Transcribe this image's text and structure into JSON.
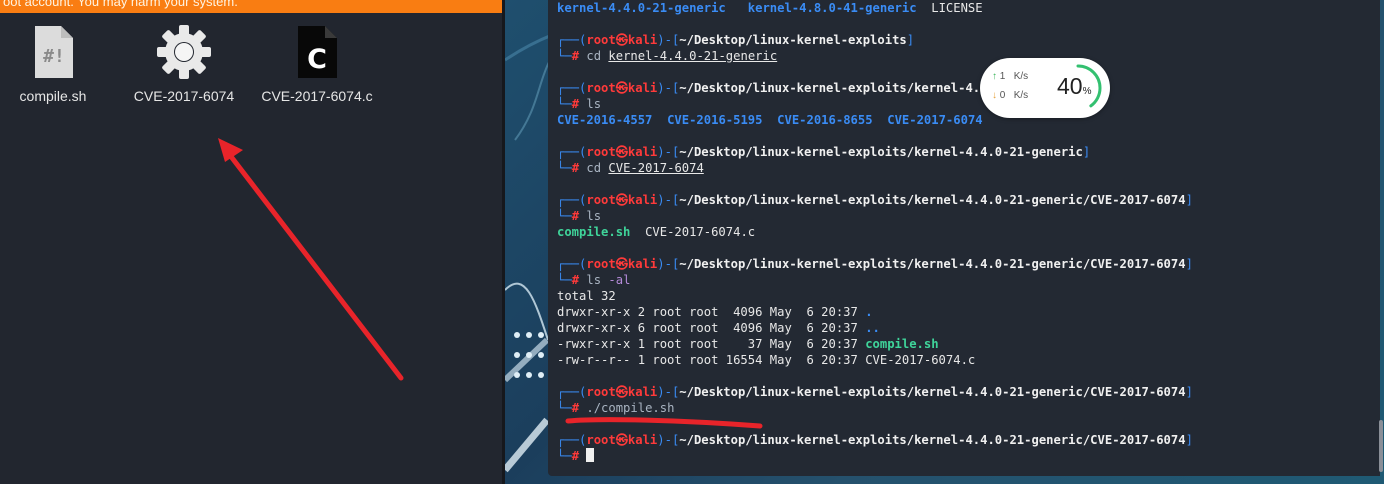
{
  "warning_banner": "oot account. You may harm your system.",
  "files": [
    {
      "name": "compile.sh",
      "icon": "shell-script-icon"
    },
    {
      "name": "CVE-2017-6074",
      "icon": "gear-executable-icon"
    },
    {
      "name": "CVE-2017-6074.c",
      "icon": "c-source-file-icon"
    }
  ],
  "icons": {
    "shell_glyph": "#!",
    "c_glyph": "C"
  },
  "network": {
    "up_value": "1",
    "up_unit": "K/s",
    "down_value": "0",
    "down_unit": "K/s",
    "percent": "40",
    "percent_sign": "%",
    "percent_fraction": 0.4
  },
  "terminal": {
    "line0": {
      "a": "kernel-4.4.0-21-generic",
      "b": "kernel-4.8.0-41-generic",
      "c": "LICENSE"
    },
    "prompt_user": "root",
    "prompt_at": "㉿",
    "prompt_host": "kali",
    "hash": "#",
    "blocks": [
      {
        "path": "~/Desktop/linux-kernel-exploits",
        "cmd": "cd",
        "arg": "kernel-4.4.0-21-generic"
      },
      {
        "path": "~/Desktop/linux-kernel-exploits/kernel-4.4.0-21-generic",
        "cmd": "ls",
        "arg": ""
      },
      {
        "path": "~/Desktop/linux-kernel-exploits/kernel-4.4.0-21-generic",
        "cmd": "cd",
        "arg": "CVE-2017-6074"
      },
      {
        "path": "~/Desktop/linux-kernel-exploits/kernel-4.4.0-21-generic/CVE-2017-6074",
        "cmd": "ls",
        "arg": ""
      },
      {
        "path": "~/Desktop/linux-kernel-exploits/kernel-4.4.0-21-generic/CVE-2017-6074",
        "cmd": "ls",
        "arg": "-al"
      },
      {
        "path": "~/Desktop/linux-kernel-exploits/kernel-4.4.0-21-generic/CVE-2017-6074",
        "cmd": "./compile.sh",
        "arg": ""
      },
      {
        "path": "~/Desktop/linux-kernel-exploits/kernel-4.4.0-21-generic/CVE-2017-6074",
        "cmd": "",
        "arg": ""
      }
    ],
    "ls1": [
      "CVE-2016-4557",
      "CVE-2016-5195",
      "CVE-2016-8655",
      "CVE-2017-6074"
    ],
    "ls2": {
      "exec": "compile.sh",
      "file": "CVE-2017-6074.c"
    },
    "ls_al": {
      "total": "total 32",
      "rows": [
        {
          "meta": "drwxr-xr-x 2 root root  4096 May  6 20:37 ",
          "name": "."
        },
        {
          "meta": "drwxr-xr-x 6 root root  4096 May  6 20:37 ",
          "name": ".."
        },
        {
          "meta": "-rwxr-xr-x 1 root root    37 May  6 20:37 ",
          "name": "compile.sh"
        },
        {
          "meta": "-rw-r--r-- 1 root root 16554 May  6 20:37 ",
          "name": "CVE-2017-6074.c"
        }
      ]
    }
  },
  "colors": {
    "accent_orange": "#f97d12",
    "prompt_red": "#ff3a3a",
    "path_blue": "#3a8cf5",
    "exec_green": "#3fd49a",
    "annotation_red": "#e8242a"
  }
}
